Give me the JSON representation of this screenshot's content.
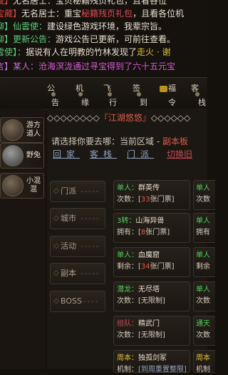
{
  "colors": {
    "channel_red": "#d9433b",
    "speaker_yellow": "#e6c84a",
    "text_cream": "#e7dfd0",
    "ad_red": "#e04b56",
    "ad_gold": "#e0c23a",
    "magenta": "#d65ad6",
    "channel_green": "#5fc87a",
    "world_purple": "#c46fd8",
    "green_label": "#4fcf5a",
    "blue_label": "#7b8fd6",
    "red_value": "#e25b4b"
  },
  "chat": {
    "lines": [
      {
        "channel": "藏】",
        "speaker": "无名居士：",
        "text": "宝贝秘籍残页礼包，且看各位"
      },
      {
        "channel": "宝藏】",
        "speaker": "无名居士：",
        "text_a": "重宝",
        "item": "秘籍残页礼包",
        "text_b": "，且看各位机"
      },
      {
        "channel": "聊】",
        "speaker": "仙雲使：",
        "text": "建设绿色游戏环境，我辈宗旨。"
      },
      {
        "channel": "聊】",
        "speaker": "更新公告：",
        "text": "游戏公告已更新，可前往查看。"
      },
      {
        "channel": "雲使】：",
        "text": "据说有人在明教的竹林发现了",
        "item": "走火 · 谢"
      },
      {
        "channel": "言】",
        "speaker": "某人：",
        "text": "沧海溟泷通过寻宝得到了六十五元宝"
      }
    ]
  },
  "nav": {
    "items": [
      {
        "top": "公",
        "bottom": "告"
      },
      {
        "top": "机",
        "bottom": "缘"
      },
      {
        "top": "飞",
        "bottom": "行"
      },
      {
        "top": "签",
        "bottom": "到"
      },
      {
        "top": "福",
        "bottom": "令"
      },
      {
        "top": "客",
        "bottom": "栈"
      }
    ]
  },
  "sidebar": {
    "characters": [
      {
        "name": "游方道人"
      },
      {
        "name": "野兔"
      },
      {
        "name": "小混混"
      }
    ]
  },
  "panel": {
    "title_prefix": "◇◇◇◇◇◇◇◇",
    "title_open": "『",
    "title": "江湖悠悠",
    "title_close": "』",
    "title_suffix": "◇◇◇◇◇◇",
    "prompt": "请选择你要去哪：当前区域 - ",
    "region": "副本板",
    "links": [
      "回家",
      "客栈",
      "门派"
    ],
    "switch_link": "切换旧"
  },
  "categories": [
    {
      "label": "门派"
    },
    {
      "label": "城市"
    },
    {
      "label": "活动"
    },
    {
      "label": "副本"
    },
    {
      "label": "BOSS"
    }
  ],
  "events": [
    {
      "tag": "单人：",
      "name": "群英传",
      "count_label": "次数：",
      "count_open": "[",
      "count": "33",
      "count_unit": "张门票",
      "count_close": "]"
    },
    {
      "tag": "3转：",
      "name": "山海异兽",
      "count_label": "拥有：",
      "count_open": "[",
      "count": "8",
      "count_unit": "张门票",
      "count_close": "]"
    },
    {
      "tag": "单人：",
      "name": "血魔窟",
      "count_label": "剩余：",
      "count_open": "[",
      "count": "34",
      "count_unit": "张门票",
      "count_close": "]"
    },
    {
      "tag": "潜龙：",
      "name": "无尽塔",
      "count_label": "次数：",
      "count_open": "",
      "count": "",
      "count_unit": "[无限制]",
      "count_close": ""
    },
    {
      "tag": "组队：",
      "name": "精武门",
      "count_label": "次数：",
      "count_open": "",
      "count": "",
      "count_unit": "[无限制]",
      "count_close": ""
    },
    {
      "tag": "周本：",
      "name": "独孤剑冢",
      "count_label": "机制：",
      "count_open": "",
      "count": "",
      "count_unit": "[到周重置整限]",
      "count_close": ""
    }
  ],
  "events_right": [
    {
      "tag": "单人",
      "line2": "次数"
    },
    {
      "tag": "单人",
      "line2": "拥有"
    },
    {
      "tag": "单人",
      "line2": "剩余"
    },
    {
      "tag": "单人",
      "line2": "次数"
    },
    {
      "tag": "通天",
      "line2": "次数"
    },
    {
      "tag": "周本",
      "line2": "机制"
    }
  ]
}
